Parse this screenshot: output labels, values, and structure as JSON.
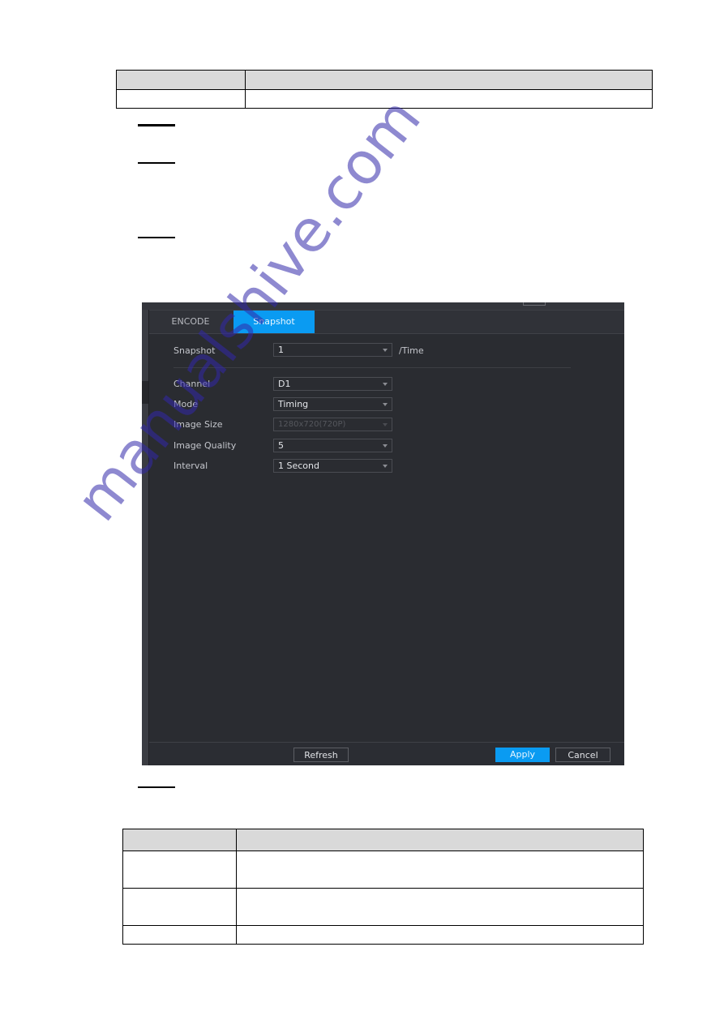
{
  "document": {
    "top_table": {
      "header": [
        "",
        ""
      ],
      "rows": [
        [
          "",
          ""
        ]
      ]
    },
    "bottom_table": {
      "header": [
        "",
        ""
      ],
      "rows": [
        [
          "",
          ""
        ],
        [
          "",
          ""
        ],
        [
          "",
          ""
        ]
      ]
    },
    "step_markers": 4
  },
  "ui": {
    "tabs": [
      {
        "label": "ENCODE",
        "active": false
      },
      {
        "label": "Snapshot",
        "active": true
      }
    ],
    "snapshot": {
      "label": "Snapshot",
      "value": "1",
      "suffix": "/Time"
    },
    "fields": [
      {
        "label": "Channel",
        "value": "D1",
        "disabled": false
      },
      {
        "label": "Mode",
        "value": "Timing",
        "disabled": false
      },
      {
        "label": "Image Size",
        "value": "1280x720(720P)",
        "disabled": true
      },
      {
        "label": "Image Quality",
        "value": "5",
        "disabled": false
      },
      {
        "label": "Interval",
        "value": "1 Second",
        "disabled": false
      }
    ],
    "buttons": {
      "refresh": "Refresh",
      "apply": "Apply",
      "cancel": "Cancel"
    },
    "colors": {
      "accent": "#0a9bf2",
      "panel_bg": "#2a2c31"
    }
  },
  "watermark": "manualshive.com"
}
